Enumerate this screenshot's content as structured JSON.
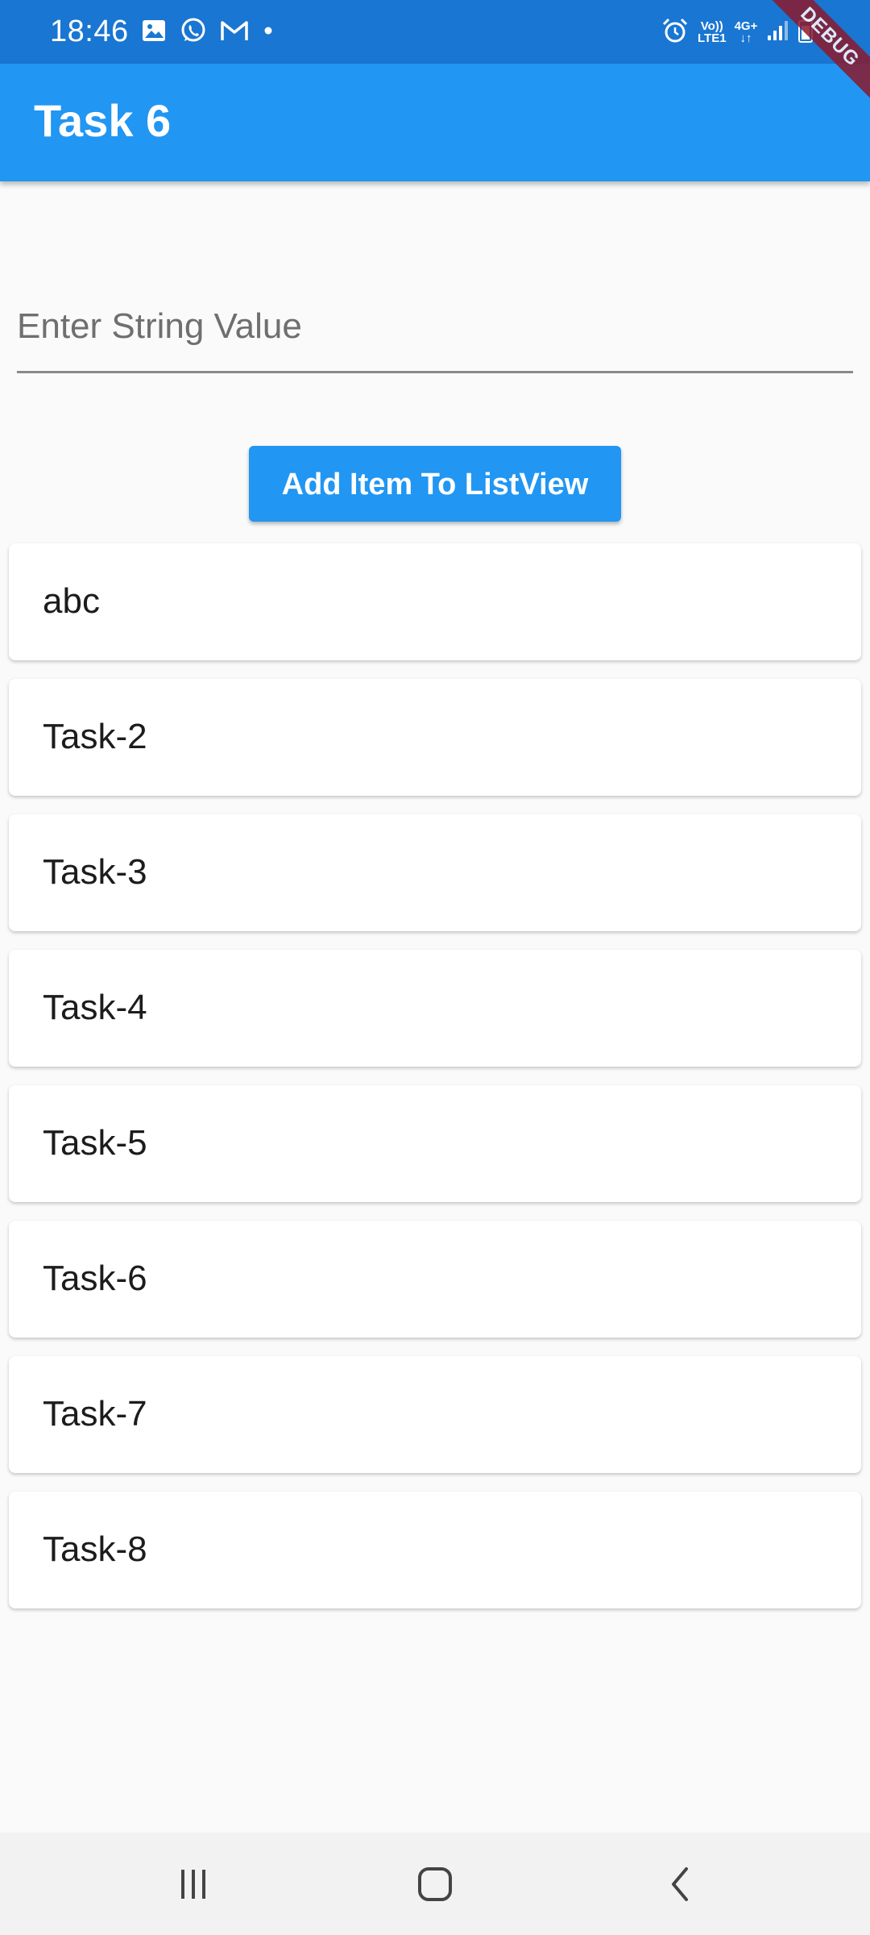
{
  "status_bar": {
    "time": "18:46",
    "left_icons": [
      "image-icon",
      "whatsapp-icon",
      "gmail-icon",
      "dot-icon"
    ],
    "right_icons": [
      "alarm-icon",
      "volte-icon",
      "4g-icon",
      "signal-icon",
      "battery-icon"
    ],
    "volte_line1": "Vo))",
    "volte_line2": "LTE1",
    "network_line1": "4G+",
    "network_line2": "↓↑"
  },
  "debug_banner": "DEBUG",
  "app_bar": {
    "title": "Task 6"
  },
  "text_field": {
    "placeholder": "Enter String Value",
    "value": ""
  },
  "add_button": {
    "label": "Add Item To ListView"
  },
  "list": {
    "items": [
      {
        "label": "abc"
      },
      {
        "label": "Task-2"
      },
      {
        "label": "Task-3"
      },
      {
        "label": "Task-4"
      },
      {
        "label": "Task-5"
      },
      {
        "label": "Task-6"
      },
      {
        "label": "Task-7"
      },
      {
        "label": "Task-8"
      }
    ]
  },
  "nav_bar": {
    "buttons": [
      "recent-apps-icon",
      "home-icon",
      "back-icon"
    ]
  },
  "colors": {
    "status_bar": "#1976d2",
    "app_bar": "#2196f3",
    "button": "#2196f3",
    "background": "#fafafa",
    "debug_banner": "#8b1a2e"
  }
}
